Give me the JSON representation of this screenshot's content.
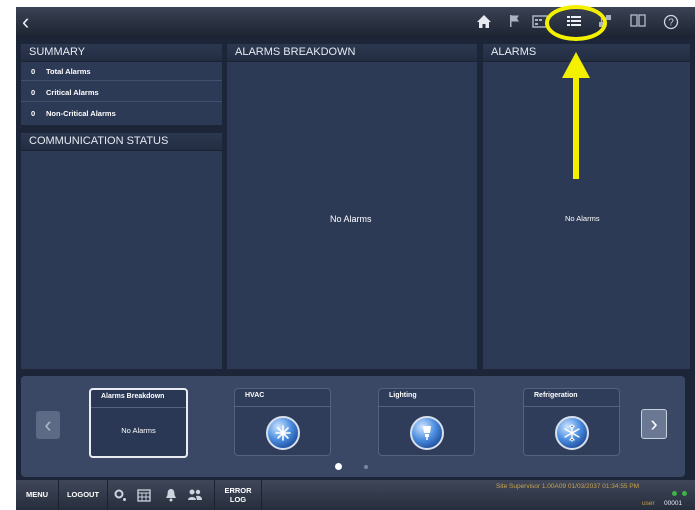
{
  "topbar": {
    "back_icon": "‹",
    "icons": [
      "home-icon",
      "flag-icon",
      "calendar-icon",
      "list-icon",
      "network-icon",
      "book-icon",
      "help-icon"
    ]
  },
  "summary": {
    "title": "SUMMARY",
    "rows": [
      {
        "count": "0",
        "label": "Total Alarms"
      },
      {
        "count": "0",
        "label": "Critical Alarms"
      },
      {
        "count": "0",
        "label": "Non-Critical Alarms"
      }
    ]
  },
  "communication": {
    "title": "COMMUNICATION STATUS"
  },
  "breakdown": {
    "title": "ALARMS BREAKDOWN",
    "empty": "No Alarms"
  },
  "alarms": {
    "title": "ALARMS",
    "empty": "No Alarms"
  },
  "carousel": {
    "tiles": [
      {
        "label": "Alarms Breakdown",
        "body": "No Alarms"
      },
      {
        "label": "HVAC"
      },
      {
        "label": "Lighting"
      },
      {
        "label": "Refrigeration"
      }
    ],
    "page": 1,
    "pages": 2
  },
  "bottombar": {
    "menu": "MENU",
    "logout": "LOGOUT",
    "error_log_1": "ERROR",
    "error_log_2": "LOG",
    "status": "Site Supervisor 1.00A09 01/03/2037 01:34:55 PM",
    "user": "user",
    "id": "00001"
  },
  "colors": {
    "background": "#1d2638",
    "panel": "#2d3a55",
    "annotation": "#f3f000",
    "status_text": "#c8a24a"
  }
}
